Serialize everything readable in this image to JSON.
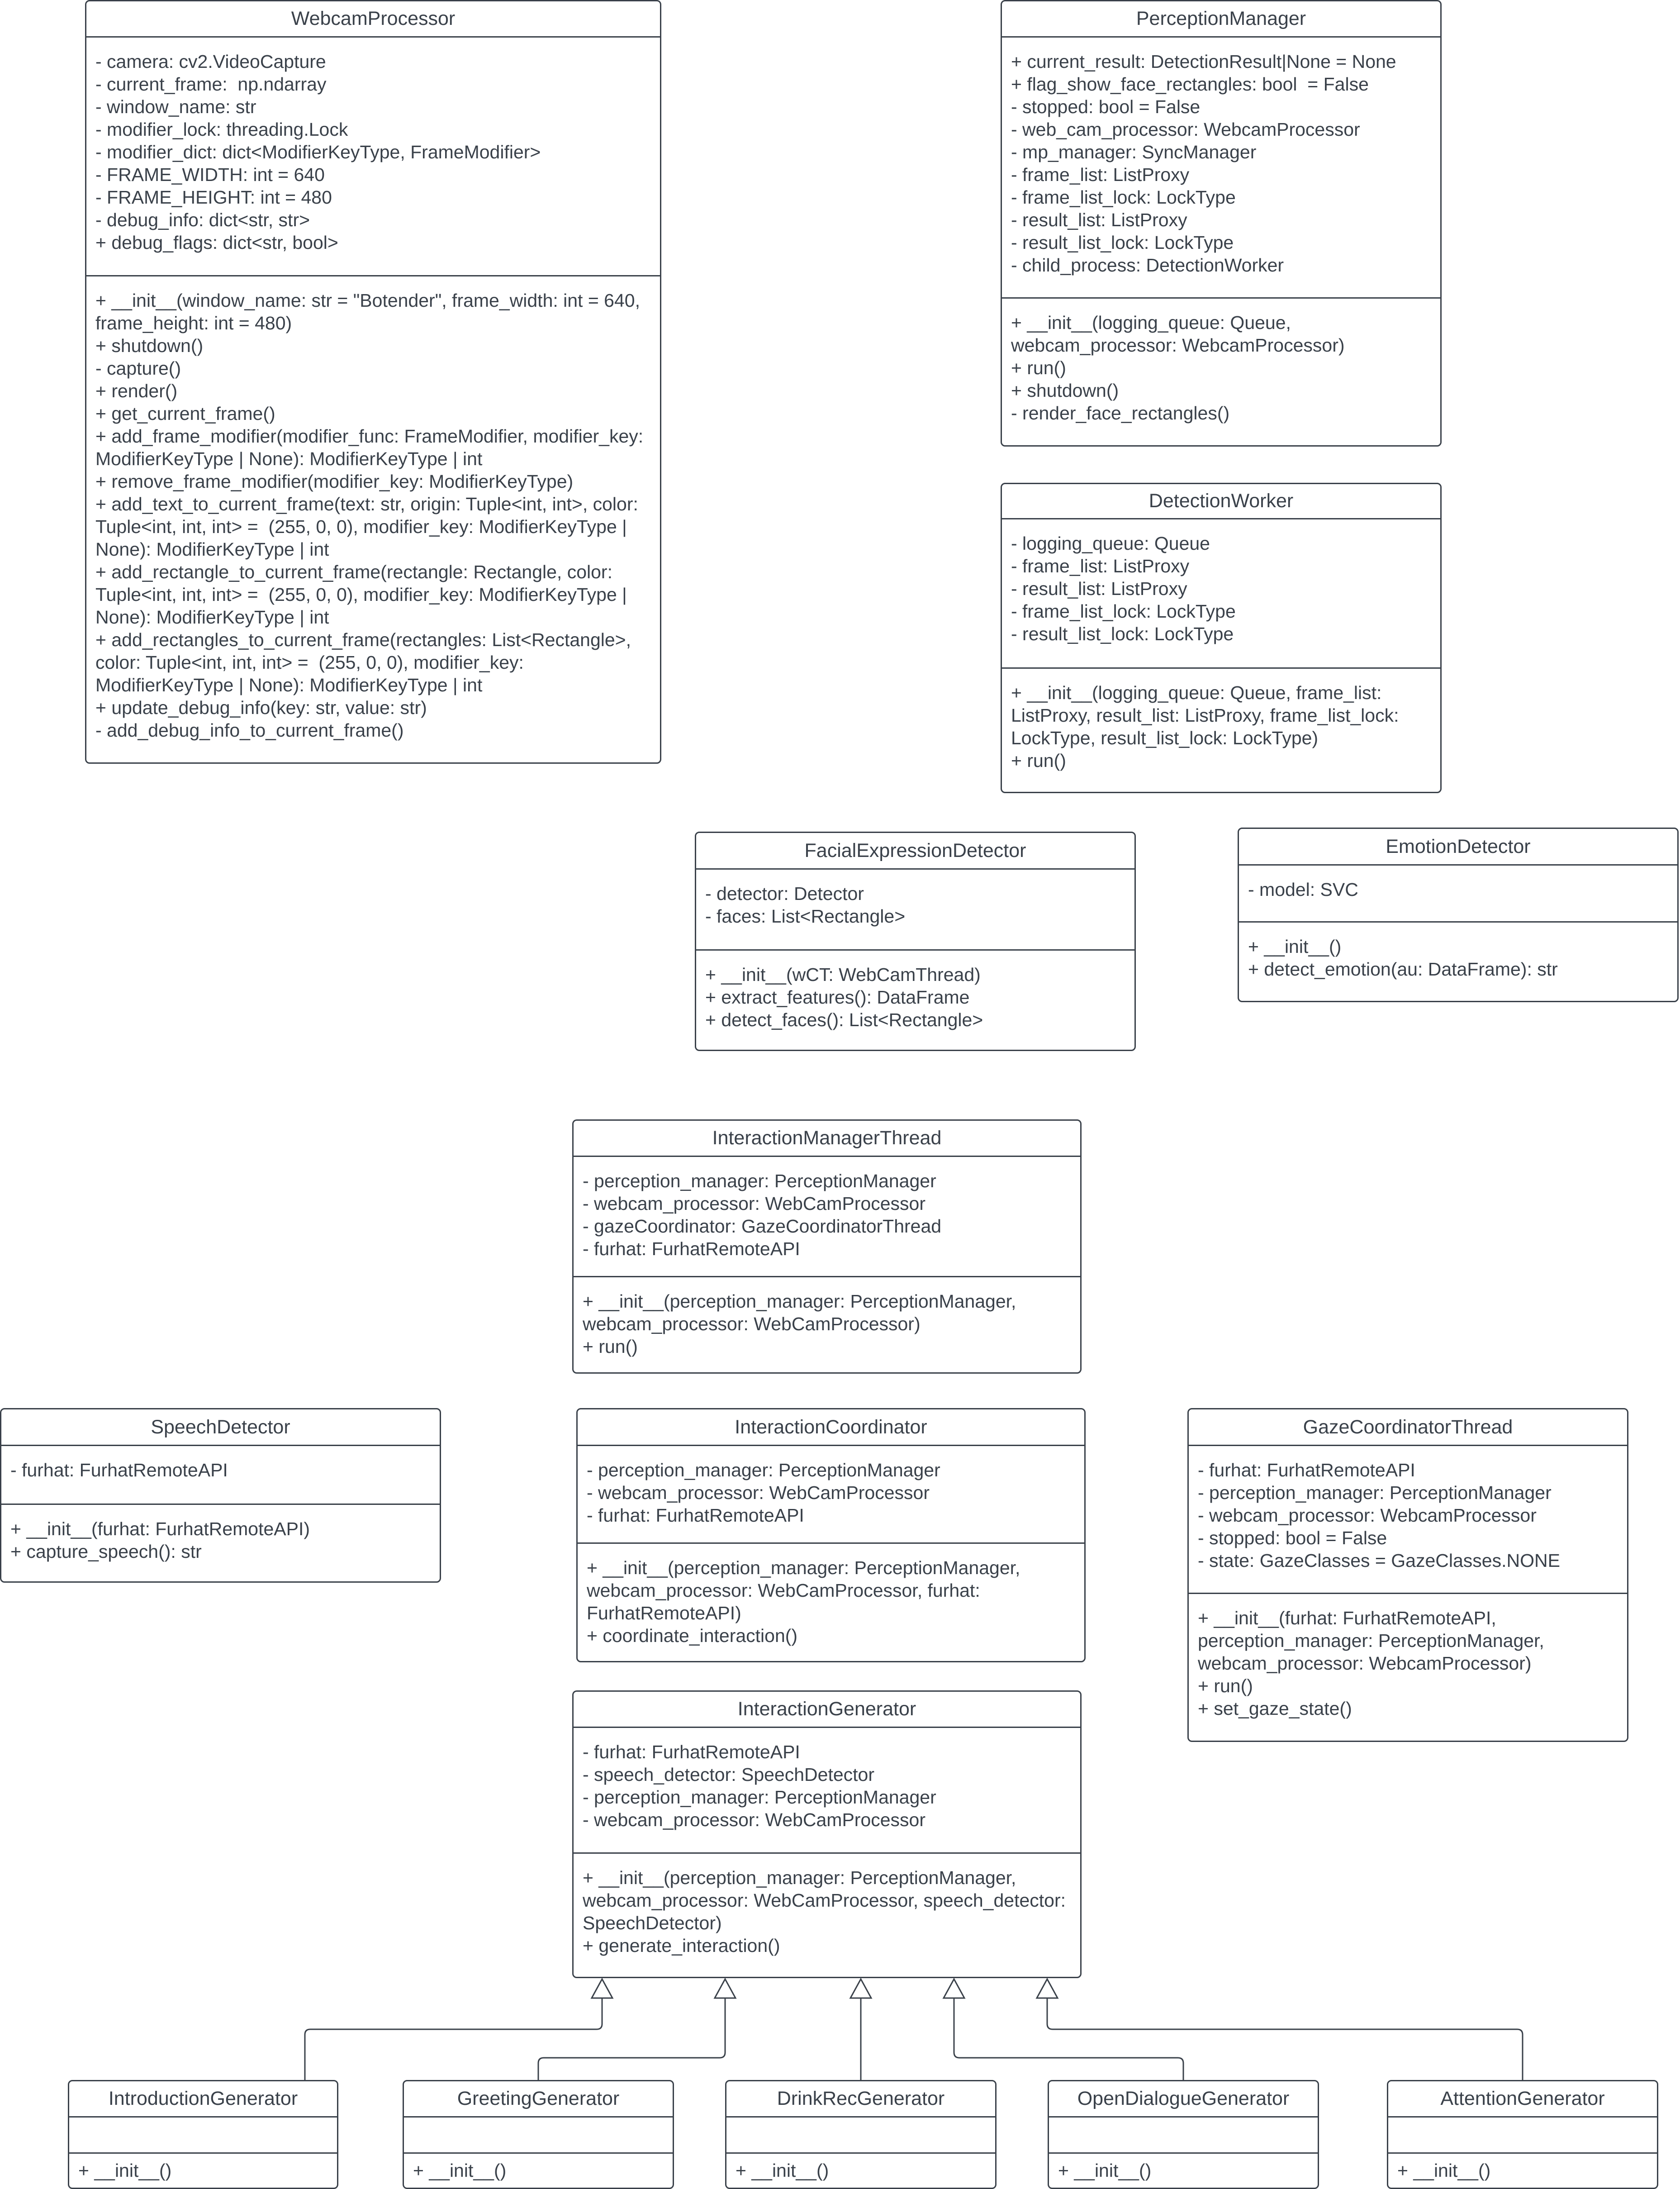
{
  "diagram": {
    "type": "UML class diagram",
    "classes": {
      "webcam_processor": {
        "name": "WebcamProcessor",
        "attributes": [
          "- camera: cv2.VideoCapture",
          "- current_frame:  np.ndarray",
          "- window_name: str",
          "- modifier_lock: threading.Lock",
          "- modifier_dict: dict<ModifierKeyType, FrameModifier>",
          "- FRAME_WIDTH: int = 640",
          "- FRAME_HEIGHT: int = 480",
          "- debug_info: dict<str, str>",
          "+ debug_flags: dict<str, bool>"
        ],
        "methods": [
          "+ __init__(window_name: str = \"Botender\", frame_width: int = 640, frame_height: int = 480)",
          "+ shutdown()",
          "- capture()",
          "+ render()",
          "+ get_current_frame()",
          "+ add_frame_modifier(modifier_func: FrameModifier, modifier_key: ModifierKeyType | None): ModifierKeyType | int",
          "+ remove_frame_modifier(modifier_key: ModifierKeyType)",
          "+ add_text_to_current_frame(text: str, origin: Tuple<int, int>, color: Tuple<int, int, int> =  (255, 0, 0), modifier_key: ModifierKeyType | None): ModifierKeyType | int",
          "+ add_rectangle_to_current_frame(rectangle: Rectangle, color: Tuple<int, int, int> =  (255, 0, 0), modifier_key: ModifierKeyType | None): ModifierKeyType | int",
          "+ add_rectangles_to_current_frame(rectangles: List<Rectangle>, color: Tuple<int, int, int> =  (255, 0, 0), modifier_key: ModifierKeyType | None): ModifierKeyType | int",
          "+ update_debug_info(key: str, value: str)",
          "- add_debug_info_to_current_frame()"
        ]
      },
      "perception_manager": {
        "name": "PerceptionManager",
        "attributes": [
          "+ current_result: DetectionResult|None = None",
          "+ flag_show_face_rectangles: bool  = False",
          "- stopped: bool = False",
          "- web_cam_processor: WebcamProcessor",
          "- mp_manager: SyncManager",
          "- frame_list: ListProxy",
          "- frame_list_lock: LockType",
          "- result_list: ListProxy",
          "- result_list_lock: LockType",
          "- child_process: DetectionWorker"
        ],
        "methods": [
          "+ __init__(logging_queue: Queue, webcam_processor: WebcamProcessor)",
          "+ run()",
          "+ shutdown()",
          "- render_face_rectangles()"
        ]
      },
      "detection_worker": {
        "name": "DetectionWorker",
        "attributes": [
          "- logging_queue: Queue",
          "- frame_list: ListProxy",
          "- result_list: ListProxy",
          "- frame_list_lock: LockType",
          "- result_list_lock: LockType"
        ],
        "methods": [
          "+ __init__(logging_queue: Queue, frame_list: ListProxy, result_list: ListProxy, frame_list_lock: LockType, result_list_lock: LockType)",
          "+ run()"
        ]
      },
      "facial_expression_detector": {
        "name": "FacialExpressionDetector",
        "attributes": [
          "- detector: Detector",
          "- faces: List<Rectangle>"
        ],
        "methods": [
          "+ __init__(wCT: WebCamThread)",
          "+ extract_features(): DataFrame",
          "+ detect_faces(): List<Rectangle>"
        ]
      },
      "emotion_detector": {
        "name": "EmotionDetector",
        "attributes": [
          "- model: SVC"
        ],
        "methods": [
          "+ __init__()",
          "+ detect_emotion(au: DataFrame): str"
        ]
      },
      "interaction_manager_thread": {
        "name": "InteractionManagerThread",
        "attributes": [
          "- perception_manager: PerceptionManager",
          "- webcam_processor: WebCamProcessor",
          "- gazeCoordinator: GazeCoordinatorThread",
          "- furhat: FurhatRemoteAPI"
        ],
        "methods": [
          "+ __init__(perception_manager: PerceptionManager, webcam_processor: WebCamProcessor)",
          "+ run()"
        ]
      },
      "speech_detector": {
        "name": "SpeechDetector",
        "attributes": [
          "- furhat: FurhatRemoteAPI"
        ],
        "methods": [
          "+ __init__(furhat: FurhatRemoteAPI)",
          "+ capture_speech(): str"
        ]
      },
      "interaction_coordinator": {
        "name": "InteractionCoordinator",
        "attributes": [
          "- perception_manager: PerceptionManager",
          "- webcam_processor: WebCamProcessor",
          "- furhat: FurhatRemoteAPI"
        ],
        "methods": [
          "+ __init__(perception_manager: PerceptionManager, webcam_processor: WebCamProcessor, furhat: FurhatRemoteAPI)",
          "+ coordinate_interaction()"
        ]
      },
      "gaze_coordinator_thread": {
        "name": "GazeCoordinatorThread",
        "attributes": [
          "- furhat: FurhatRemoteAPI",
          "- perception_manager: PerceptionManager",
          "- webcam_processor: WebcamProcessor",
          "- stopped: bool = False",
          "- state: GazeClasses = GazeClasses.NONE"
        ],
        "methods": [
          "+ __init__(furhat: FurhatRemoteAPI, perception_manager: PerceptionManager, webcam_processor: WebcamProcessor)",
          "+ run()",
          "+ set_gaze_state()"
        ]
      },
      "interaction_generator": {
        "name": "InteractionGenerator",
        "attributes": [
          "- furhat: FurhatRemoteAPI",
          "- speech_detector: SpeechDetector",
          "- perception_manager: PerceptionManager",
          "- webcam_processor: WebCamProcessor"
        ],
        "methods": [
          "+ __init__(perception_manager: PerceptionManager, webcam_processor: WebCamProcessor, speech_detector: SpeechDetector)",
          "+ generate_interaction()"
        ]
      },
      "introduction_generator": {
        "name": "IntroductionGenerator",
        "attributes": [],
        "methods": [
          "+ __init__()"
        ]
      },
      "greeting_generator": {
        "name": "GreetingGenerator",
        "attributes": [],
        "methods": [
          "+ __init__()"
        ]
      },
      "drink_rec_generator": {
        "name": "DrinkRecGenerator",
        "attributes": [],
        "methods": [
          "+ __init__()"
        ]
      },
      "open_dialogue_generator": {
        "name": "OpenDialogueGenerator",
        "attributes": [],
        "methods": [
          "+ __init__()"
        ]
      },
      "attention_generator": {
        "name": "AttentionGenerator",
        "attributes": [],
        "methods": [
          "+ __init__()"
        ]
      }
    },
    "relationships": [
      {
        "type": "inheritance",
        "from": "IntroductionGenerator",
        "to": "InteractionGenerator"
      },
      {
        "type": "inheritance",
        "from": "GreetingGenerator",
        "to": "InteractionGenerator"
      },
      {
        "type": "inheritance",
        "from": "DrinkRecGenerator",
        "to": "InteractionGenerator"
      },
      {
        "type": "inheritance",
        "from": "OpenDialogueGenerator",
        "to": "InteractionGenerator"
      },
      {
        "type": "inheritance",
        "from": "AttentionGenerator",
        "to": "InteractionGenerator"
      }
    ],
    "colors": {
      "stroke": "#3a414a",
      "text": "#3a414a",
      "background": "#ffffff"
    }
  }
}
